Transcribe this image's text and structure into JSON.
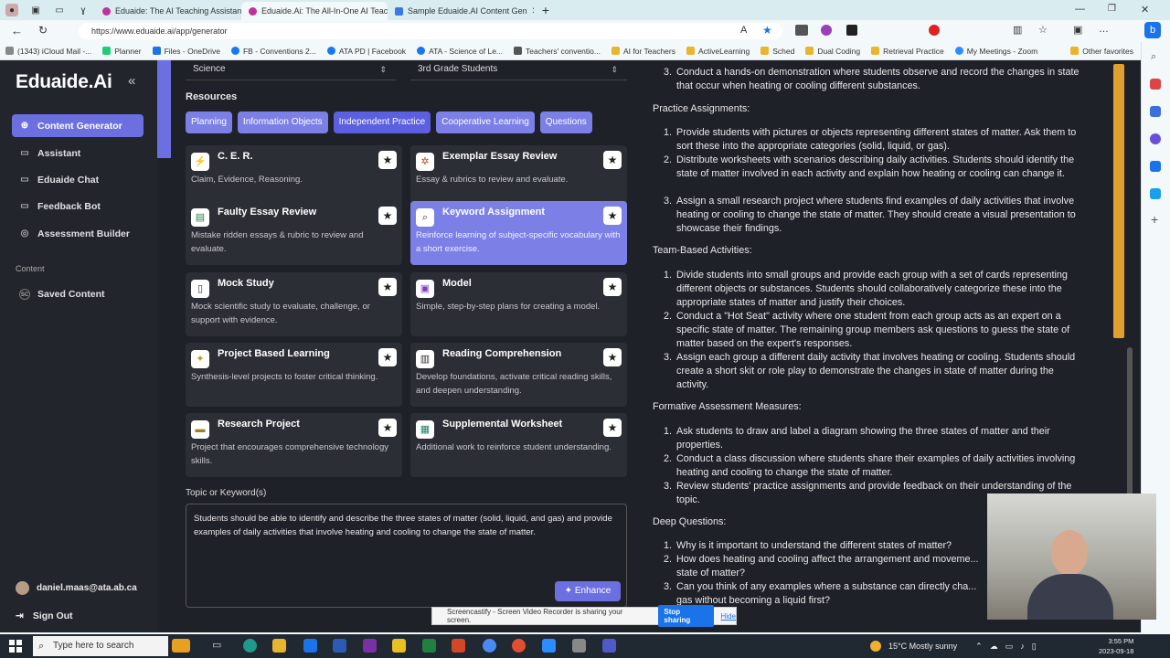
{
  "browser": {
    "tabs": [
      {
        "label": "Eduaide: The AI Teaching Assistant",
        "color": "#c0309a"
      },
      {
        "label": "Eduaide.Ai: The All-In-One AI Teaching",
        "color": "#c0309a"
      },
      {
        "label": "Sample Eduaide.AI Content Gen",
        "color": "#3b78e7"
      }
    ],
    "url": "https://www.eduaide.ai/app/generator",
    "bookmarks": [
      "(1343) iCloud Mail -...",
      "Planner",
      "Files - OneDrive",
      "FB - Conventions 2...",
      "ATA PD | Facebook",
      "ATA - Science of Le...",
      "Teachers' conventio...",
      "AI for Teachers",
      "ActiveLearning",
      "Sched",
      "Dual Coding",
      "Retrieval Practice",
      "My Meetings - Zoom",
      "Other favorites"
    ]
  },
  "sidebar": {
    "logo": "Eduaide.Ai",
    "collapse_icon": "«",
    "items": [
      {
        "label": "Content Generator",
        "icon": "⊕"
      },
      {
        "label": "Assistant",
        "icon": "▭"
      },
      {
        "label": "Eduaide Chat",
        "icon": "▭"
      },
      {
        "label": "Feedback Bot",
        "icon": "▭"
      },
      {
        "label": "Assessment Builder",
        "icon": "◎"
      }
    ],
    "section_label": "Content",
    "saved": {
      "label": "Saved Content",
      "icon": "SC"
    },
    "user_email": "daniel.maas@ata.ab.ca",
    "sign_out": "Sign Out"
  },
  "main": {
    "subject": "Science",
    "grade": "3rd Grade Students",
    "resources_title": "Resources",
    "tabs": [
      "Planning",
      "Information Objects",
      "Independent Practice",
      "Cooperative Learning",
      "Questions"
    ],
    "active_tab": "Independent Practice",
    "cards": [
      {
        "title": "C. E. R.",
        "desc": "Claim, Evidence, Reasoning.",
        "icon": "⚡"
      },
      {
        "title": "Exemplar Essay Review",
        "desc": "Essay & rubrics to review and evaluate.",
        "icon": "✲"
      },
      {
        "title": "Faulty Essay Review",
        "desc": "Mistake ridden essays & rubric to review and evaluate.",
        "icon": "▤"
      },
      {
        "title": "Keyword Assignment",
        "desc": "Reinforce learning of subject-specific vocabulary with a short exercise.",
        "icon": "⌕"
      },
      {
        "title": "Mock Study",
        "desc": "Mock scientific study to evaluate, challenge, or support with evidence.",
        "icon": "▯"
      },
      {
        "title": "Model",
        "desc": "Simple, step-by-step plans for creating a model.",
        "icon": "▣"
      },
      {
        "title": "Project Based Learning",
        "desc": "Synthesis-level projects to foster critical thinking.",
        "icon": "✦"
      },
      {
        "title": "Reading Comprehension",
        "desc": "Develop foundations, activate critical reading skills, and deepen understanding.",
        "icon": "▥"
      },
      {
        "title": "Research Project",
        "desc": "Project that encourages comprehensive technology skills.",
        "icon": "▬"
      },
      {
        "title": "Supplemental Worksheet",
        "desc": "Additional work to reinforce student understanding.",
        "icon": "▦"
      }
    ],
    "star_icon": "★",
    "topic_label": "Topic or Keyword(s)",
    "topic_value": "Students should be able to identify and describe the three states of matter (solid, liquid, and gas) and provide examples of daily activities that involve heating and cooling to change the state of matter.",
    "enhance_label": "Enhance"
  },
  "output": {
    "l0": "Conduct a hands-on demonstration where students observe and record the changes in state that occur when heating or cooling different substances.",
    "h1": "Practice Assignments:",
    "p1": "Provide students with pictures or objects representing different states of matter. Ask them to sort these into the appropriate categories (solid, liquid, or gas).",
    "p2": "Distribute worksheets with scenarios describing daily activities. Students should identify the state of matter involved in each activity and explain how heating or cooling can change it.",
    "p3": "Assign a small research project where students find examples of daily activities that involve heating or cooling to change the state of matter. They should create a visual presentation to showcase their findings.",
    "h2": "Team-Based Activities:",
    "t1": "Divide students into small groups and provide each group with a set of cards representing different objects or substances. Students should collaboratively categorize these into the appropriate states of matter and justify their choices.",
    "t2": "Conduct a \"Hot Seat\" activity where one student from each group acts as an expert on a specific state of matter. The remaining group members ask questions to guess the state of matter based on the expert's responses.",
    "t3": "Assign each group a different daily activity that involves heating or cooling. Students should create a short skit or role play to demonstrate the changes in state of matter during the activity.",
    "h3": "Formative Assessment Measures:",
    "f1": "Ask students to draw and label a diagram showing the three states of matter and their properties.",
    "f2": "Conduct a class discussion where students share their examples of daily activities involving heating and cooling to change the state of matter.",
    "f3": "Review students' practice assignments and provide feedback on their understanding of the topic.",
    "h4": "Deep Questions:",
    "d1": "Why is it important to understand the different states of matter?",
    "d2": "How does heating and cooling affect the arrangement and moveme... state of matter?",
    "d3": "Can you think of any examples where a substance can directly cha... gas without becoming a liquid first?"
  },
  "screencast": {
    "message": "Screencastify - Screen Video Recorder is sharing your screen.",
    "stop": "Stop sharing",
    "hide": "Hide"
  },
  "taskbar": {
    "search_placeholder": "Type here to search",
    "weather": "15°C  Mostly sunny",
    "time": "3:55 PM",
    "date": "2023-09-18"
  }
}
